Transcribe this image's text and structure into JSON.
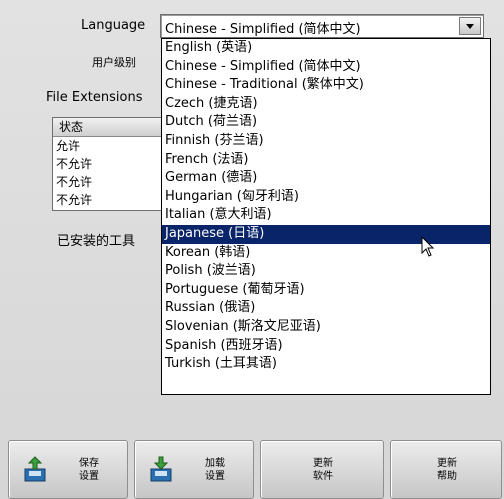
{
  "form": {
    "language_label": "Language",
    "user_level_label": "用户级别",
    "file_extensions_label": "File Extensions",
    "installed_tools_label": "已安装的工具"
  },
  "language_combo": {
    "value": "Chinese - Simplified (简体中文)"
  },
  "status_list": {
    "header": "状态",
    "rows": [
      "允许",
      "不允许",
      "不允许",
      "不允许"
    ]
  },
  "dropdown": {
    "selected_index": 10,
    "options": [
      "English (英语)",
      "Chinese - Simplified (简体中文)",
      "Chinese - Traditional (繁体中文)",
      "Czech (捷克语)",
      "Dutch (荷兰语)",
      "Finnish (芬兰语)",
      "French (法语)",
      "German (德语)",
      "Hungarian (匈牙利语)",
      "Italian (意大利语)",
      "Japanese (日语)",
      "Korean (韩语)",
      "Polish (波兰语)",
      "Portuguese (葡萄牙语)",
      "Russian (俄语)",
      "Slovenian (斯洛文尼亚语)",
      "Spanish (西班牙语)",
      "Turkish (土耳其语)"
    ]
  },
  "buttons": {
    "save": "保存\n设置",
    "load": "加载\n设置",
    "update_software": "更新\n软件",
    "update_help": "更新\n帮助"
  },
  "colors": {
    "selection": "#0a246a",
    "background": "#dcdcdc"
  }
}
